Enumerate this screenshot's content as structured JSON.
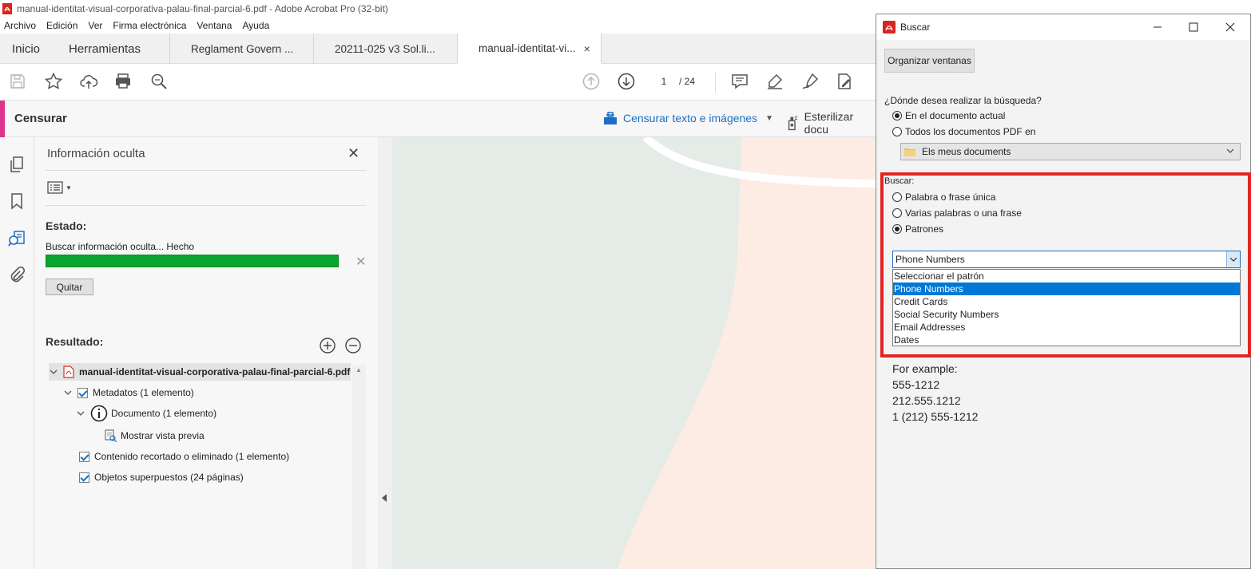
{
  "window": {
    "title": "manual-identitat-visual-corporativa-palau-final-parcial-6.pdf - Adobe Acrobat Pro (32-bit)"
  },
  "menu": [
    "Archivo",
    "Edición",
    "Ver",
    "Firma electrónica",
    "Ventana",
    "Ayuda"
  ],
  "tabs": {
    "home": "Inicio",
    "tools": "Herramientas",
    "docs": [
      {
        "label": "Reglament Govern ...",
        "active": false
      },
      {
        "label": "20211-025 v3 Sol.li...",
        "active": false
      },
      {
        "label": "manual-identitat-vi...",
        "active": true
      }
    ],
    "close_glyph": "×"
  },
  "toolbar": {
    "page_current": "1",
    "page_total": "/ 24"
  },
  "censor": {
    "label": "Censurar",
    "redact_text": "Censurar texto e imágenes",
    "sterilize_text": "Esterilizar docu",
    "accent": "#e0338f"
  },
  "panel": {
    "title": "Información oculta",
    "status_label": "Estado:",
    "status_text": "Buscar información oculta... Hecho",
    "progress": 1.0,
    "remove_button": "Quitar",
    "result_label": "Resultado:",
    "tree": {
      "root": "manual-identitat-visual-corporativa-palau-final-parcial-6.pdf",
      "metadata": "Metadatos (1 elemento)",
      "document": "Documento (1 elemento)",
      "preview": "Mostrar vista previa",
      "cropped": "Contenido recortado o eliminado (1 elemento)",
      "overlapping": "Objetos superpuestos (24 páginas)"
    }
  },
  "dialog": {
    "title": "Buscar",
    "arrange_button": "Organizar ventanas",
    "where_label": "¿Dónde desea realizar la búsqueda?",
    "where_options": [
      {
        "label": "En el documento actual",
        "checked": true
      },
      {
        "label": "Todos los documentos PDF en",
        "checked": false
      }
    ],
    "location": "Els meus documents",
    "search_label": "Buscar:",
    "search_options": [
      {
        "label": "Palabra o frase única",
        "checked": false
      },
      {
        "label": "Varias palabras o una frase",
        "checked": false
      },
      {
        "label": "Patrones",
        "checked": true
      }
    ],
    "pattern_selected": "Phone Numbers",
    "pattern_options": [
      {
        "label": "Seleccionar el patrón",
        "selected": false
      },
      {
        "label": "Phone Numbers",
        "selected": true
      },
      {
        "label": "Credit Cards",
        "selected": false
      },
      {
        "label": "Social Security Numbers",
        "selected": false
      },
      {
        "label": "Email Addresses",
        "selected": false
      },
      {
        "label": "Dates",
        "selected": false
      }
    ],
    "example_title": "For example:",
    "examples": [
      "555-1212",
      "212.555.1212",
      "1 (212) 555-1212"
    ],
    "highlight_color": "#e32323"
  }
}
